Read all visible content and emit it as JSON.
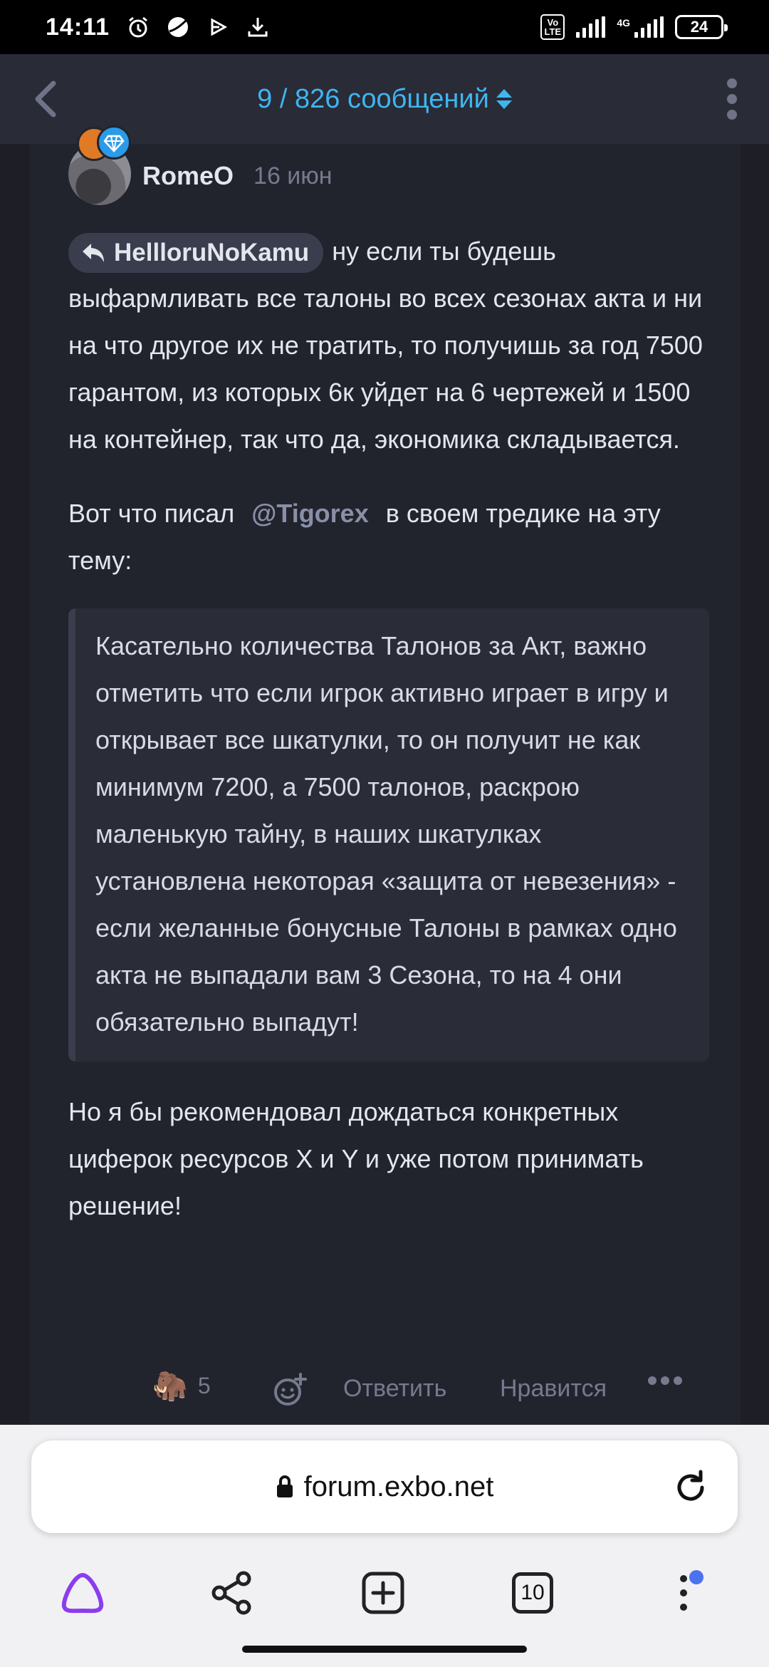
{
  "status_bar": {
    "time": "14:11",
    "left_icons": [
      "alarm-icon",
      "planet-icon",
      "play-icon",
      "download-icon"
    ],
    "volte_label": "Vo LTE",
    "network_label": "4G",
    "battery_level": "24"
  },
  "topnav": {
    "title": "9 / 826 сообщений",
    "accent_color": "#3fb5f0"
  },
  "post": {
    "author": "RomeO",
    "date": "16 июн",
    "reply_to": "HellloruNoKamu",
    "para1_rest": "ну если ты будешь выфармливать все талоны во всех сезонах акта и ни на что другое их не тратить, то получишь за год 7500 гарантом, из которых 6к уйдет на 6 чертежей и 1500 на контейнер, так что да, экономика складывается.",
    "para2_before": "Вот что писал",
    "para2_mention": "@Tigorex",
    "para2_after": "в своем тредике на эту тему:",
    "quote": "Касательно количества Талонов за Акт, важно отметить что если игрок активно играет в игру и открывает все шкатулки, то он получит не как минимум 7200, а 7500 талонов, раскрою маленькую тайну, в наших шкатулках установлена некоторая «защита от невезения» - если желанные бонусные Талоны в рамках одно акта не выпадали вам 3 Сезона, то на 4 они обязательно выпадут!",
    "para3": "Но я бы рекомендовал дождаться конкретных циферок ресурсов X и Y и уже потом принимать решение!",
    "reaction_emoji": "🦣",
    "reaction_count": "5",
    "reply_label": "Ответить",
    "like_label": "Нравится"
  },
  "browser": {
    "url": "forum.exbo.net",
    "tabs_count": "10"
  }
}
